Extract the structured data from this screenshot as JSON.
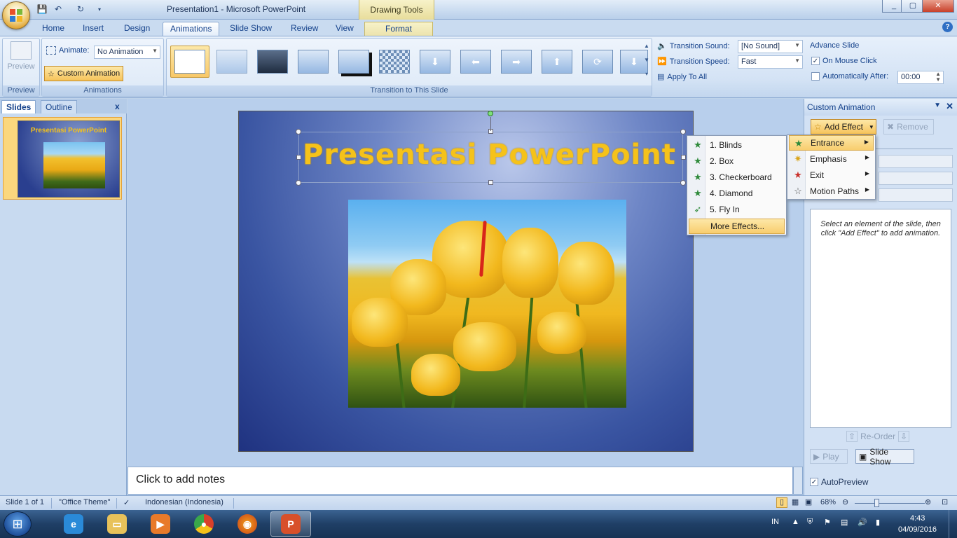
{
  "window": {
    "title": "Presentation1 - Microsoft PowerPoint",
    "contextual_tab_group": "Drawing Tools",
    "min": "_",
    "max": "▢",
    "close": "✕"
  },
  "tabs": [
    "Home",
    "Insert",
    "Design",
    "Animations",
    "Slide Show",
    "Review",
    "View",
    "Format"
  ],
  "ribbon": {
    "preview_group": {
      "button": "Preview",
      "label": "Preview"
    },
    "animations_group": {
      "animate_label": "Animate:",
      "animate_value": "No Animation",
      "custom_animation": "Custom Animation",
      "label": "Animations"
    },
    "transition_group": {
      "label": "Transition to This Slide",
      "sound_label": "Transition Sound:",
      "sound_value": "[No Sound]",
      "speed_label": "Transition Speed:",
      "speed_value": "Fast",
      "apply_all": "Apply To All"
    },
    "advance_group": {
      "title": "Advance Slide",
      "on_mouse_click": "On Mouse Click",
      "auto_after": "Automatically After:",
      "auto_value": "00:00"
    }
  },
  "left_panel": {
    "tab_slides": "Slides",
    "tab_outline": "Outline",
    "close": "x",
    "slide_number": "1",
    "thumb_title": "Presentasi PowerPoint"
  },
  "slide": {
    "title": "Presentasi PowerPoint"
  },
  "notes": {
    "placeholder": "Click to add notes"
  },
  "pane": {
    "title": "Custom Animation",
    "add_effect": "Add Effect",
    "remove": "Remove",
    "hint": "Select an element of the slide, then click \"Add Effect\" to add animation.",
    "reorder": "Re-Order",
    "play": "Play",
    "slide_show": "Slide Show",
    "autopreview": "AutoPreview"
  },
  "menu": {
    "items": [
      {
        "label": "Entrance",
        "icon": "entrance-star-icon"
      },
      {
        "label": "Emphasis",
        "icon": "emphasis-star-icon"
      },
      {
        "label": "Exit",
        "icon": "exit-star-icon"
      },
      {
        "label": "Motion Paths",
        "icon": "motion-path-icon"
      }
    ],
    "entrance_items": [
      "1. Blinds",
      "2. Box",
      "3. Checkerboard",
      "4. Diamond",
      "5. Fly In"
    ],
    "more_effects": "More Effects..."
  },
  "status": {
    "slide": "Slide 1 of 1",
    "theme": "\"Office Theme\"",
    "language": "Indonesian (Indonesia)",
    "zoom": "68%"
  },
  "taskbar": {
    "lang": "IN",
    "time": "4:43",
    "date": "04/09/2016"
  },
  "colors": {
    "accent": "#15428b",
    "title_yellow": "#f5c21a",
    "highlight": "#f8cd6e"
  }
}
